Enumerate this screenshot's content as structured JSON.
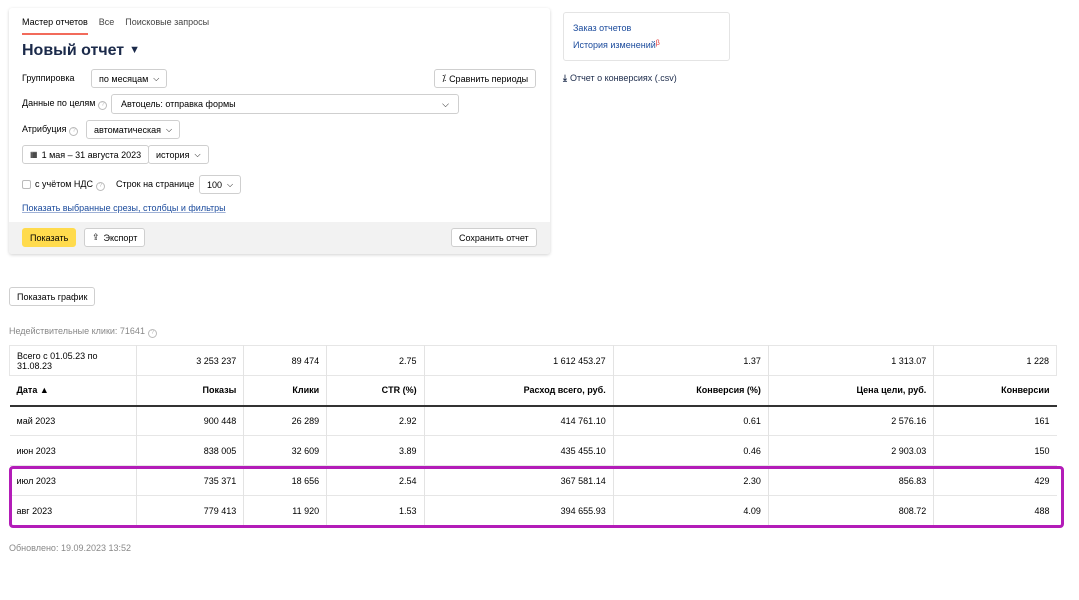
{
  "tabs": [
    {
      "label": "Мастер отчетов"
    },
    {
      "label": "Все"
    },
    {
      "label": "Поисковые запросы"
    }
  ],
  "report": {
    "title": "Новый отчет",
    "grouping_label": "Группировка",
    "grouping_value": "по месяцам",
    "compare_label": "Сравнить периоды",
    "goal_label": "Данные по целям",
    "goal_value": "Автоцель: отправка формы",
    "attribution_label": "Атрибуция",
    "attribution_value": "автоматическая",
    "date_range": "1 мая – 31 августа 2023",
    "history_value": "история",
    "vat_label": "с учётом НДС",
    "rows_label": "Строк на странице",
    "rows_value": "100",
    "slices_link": "Показать выбранные срезы, столбцы и фильтры",
    "show_button": "Показать",
    "export_button": "Экспорт",
    "save_button": "Сохранить отчет"
  },
  "side": {
    "order_reports": "Заказ отчетов",
    "history": "История изменений",
    "conversions_report": "Отчет о конверсиях (.csv)"
  },
  "show_chart_button": "Показать график",
  "invalid_clicks": "Недействительные клики: 71641",
  "table": {
    "total": [
      "Всего с 01.05.23 по 31.08.23",
      "3 253 237",
      "89 474",
      "2.75",
      "1 612 453.27",
      "1.37",
      "1 313.07",
      "1 228"
    ],
    "headers": [
      "Дата ▲",
      "Показы",
      "Клики",
      "CTR (%)",
      "Расход всего, руб.",
      "Конверсия (%)",
      "Цена цели, руб.",
      "Конверсии"
    ],
    "rows": [
      [
        "май 2023",
        "900 448",
        "26 289",
        "2.92",
        "414 761.10",
        "0.61",
        "2 576.16",
        "161"
      ],
      [
        "июн 2023",
        "838 005",
        "32 609",
        "3.89",
        "435 455.10",
        "0.46",
        "2 903.03",
        "150"
      ],
      [
        "июл 2023",
        "735 371",
        "18 656",
        "2.54",
        "367 581.14",
        "2.30",
        "856.83",
        "429"
      ],
      [
        "авг 2023",
        "779 413",
        "11 920",
        "1.53",
        "394 655.93",
        "4.09",
        "808.72",
        "488"
      ]
    ]
  },
  "updated": "Обновлено: 19.09.2023 13:52",
  "colors": {
    "accent_tab": "#f26b5b",
    "primary_button": "#ffdb4d",
    "link": "#1a4a9c",
    "highlight": "#b31cb8"
  }
}
